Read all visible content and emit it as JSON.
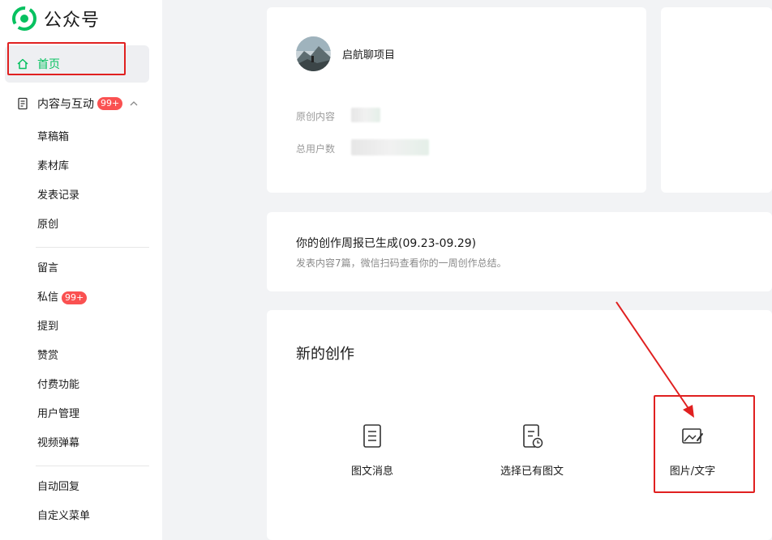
{
  "brand": {
    "name": "公众号",
    "accent": "#07c160"
  },
  "nav": {
    "home": {
      "label": "首页",
      "icon": "home-icon"
    },
    "content_group": {
      "label": "内容与互动",
      "badge": "99+",
      "icon": "document-icon"
    },
    "content_items": [
      "草稿箱",
      "素材库",
      "发表记录",
      "原创"
    ],
    "interaction_items": [
      {
        "label": "留言"
      },
      {
        "label": "私信",
        "badge": "99+"
      },
      {
        "label": "提到"
      },
      {
        "label": "赞赏"
      },
      {
        "label": "付费功能"
      },
      {
        "label": "用户管理"
      },
      {
        "label": "视频弹幕"
      }
    ],
    "settings_items": [
      "自动回复",
      "自定义菜单"
    ]
  },
  "profile": {
    "account_name": "启航聊项目",
    "stats": [
      {
        "label": "原创内容"
      },
      {
        "label": "总用户数"
      }
    ]
  },
  "report": {
    "title": "你的创作周报已生成(09.23-09.29)",
    "description": "发表内容7篇，微信扫码查看你的一周创作总结。"
  },
  "create": {
    "title": "新的创作",
    "options": [
      {
        "label": "图文消息",
        "icon": "article-icon"
      },
      {
        "label": "选择已有图文",
        "icon": "existing-article-icon"
      },
      {
        "label": "图片/文字",
        "icon": "image-text-icon"
      }
    ]
  },
  "colors": {
    "badge": "#fa5151",
    "annotation": "#e02020",
    "background": "#f2f3f5"
  }
}
